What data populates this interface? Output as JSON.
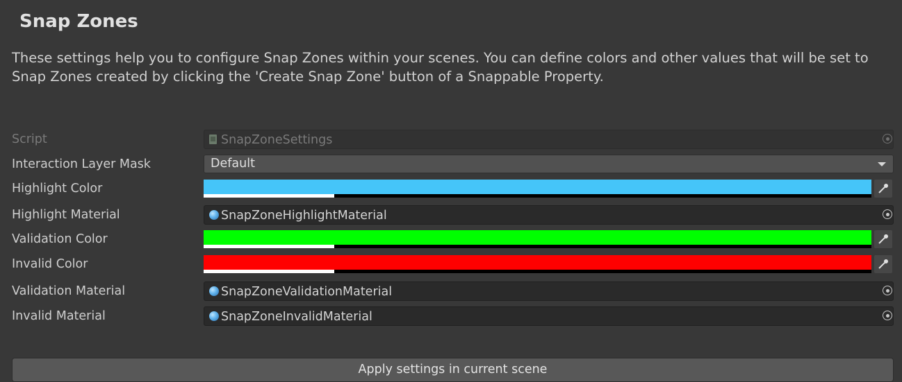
{
  "header": {
    "title": "Snap Zones",
    "description": "These settings help you to configure Snap Zones within your scenes. You can define colors and other values that will be set to Snap Zones created by clicking the 'Create Snap Zone' button of a Snappable Property."
  },
  "fields": {
    "script": {
      "label": "Script",
      "value": "SnapZoneSettings",
      "icon": "script-file-icon"
    },
    "interaction_layer_mask": {
      "label": "Interaction Layer Mask",
      "value": "Default"
    },
    "highlight_color": {
      "label": "Highlight Color",
      "color": "#45c5f9"
    },
    "highlight_material": {
      "label": "Highlight Material",
      "value": "SnapZoneHighlightMaterial",
      "icon": "material-sphere-icon"
    },
    "validation_color": {
      "label": "Validation Color",
      "color": "#00ff00"
    },
    "invalid_color": {
      "label": "Invalid Color",
      "color": "#ff0000"
    },
    "validation_material": {
      "label": "Validation Material",
      "value": "SnapZoneValidationMaterial",
      "icon": "material-sphere-icon"
    },
    "invalid_material": {
      "label": "Invalid Material",
      "value": "SnapZoneInvalidMaterial",
      "icon": "material-sphere-icon"
    }
  },
  "actions": {
    "apply_label": "Apply settings in current scene"
  },
  "colors": {
    "background": "#383838",
    "field_background": "#2a2a2a",
    "button_background": "#585858"
  }
}
